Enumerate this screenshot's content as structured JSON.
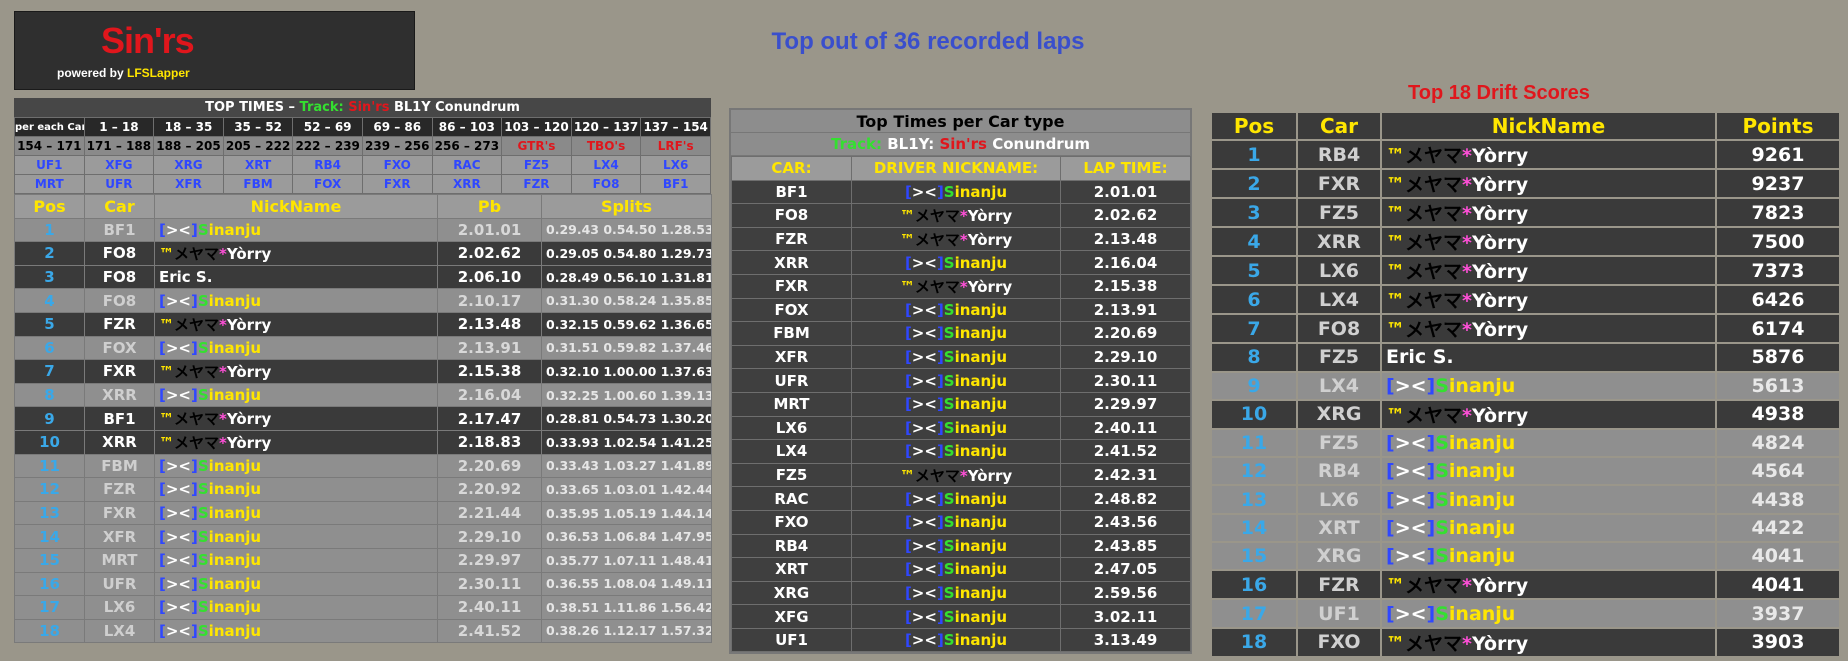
{
  "logo": {
    "main": "Sin'rs",
    "sub_prefix": "powered by ",
    "sub_brand": "LFSLapper"
  },
  "main_title": "Top out of 36 recorded laps",
  "drift_title": "Top 18 Drift Scores",
  "panel1": {
    "title_prefix": "TOP TIMES –",
    "track_label": "Track:",
    "track_team": "Sin'rs",
    "track_name": "BL1Y Conundrum",
    "grid_row1": [
      "per each Car",
      "1 – 18",
      "18 – 35",
      "35 – 52",
      "52 – 69",
      "69 – 86",
      "86 – 103",
      "103 – 120",
      "120 – 137",
      "137 – 154"
    ],
    "grid_row2": [
      "154 – 171",
      "171 – 188",
      "188 – 205",
      "205 – 222",
      "222 – 239",
      "239 – 256",
      "256 – 273",
      "GTR's",
      "TBO's",
      "LRF's"
    ],
    "grid_row3": [
      "UF1",
      "XFG",
      "XRG",
      "XRT",
      "RB4",
      "FXO",
      "RAC",
      "FZ5",
      "LX4",
      "LX6"
    ],
    "grid_row4": [
      "MRT",
      "UFR",
      "XFR",
      "FBM",
      "FOX",
      "FXR",
      "XRR",
      "FZR",
      "FO8",
      "BF1"
    ],
    "headers": [
      "Pos",
      "Car",
      "NickName",
      "Pb",
      "Splits"
    ],
    "rows": [
      {
        "pos": "1",
        "car": "BF1",
        "nick": "sinanju",
        "pb": "2.01.01",
        "splits": "0.29.43 0.54.50 1.28.53",
        "shade": "light"
      },
      {
        "pos": "2",
        "car": "FO8",
        "nick": "yorry",
        "pb": "2.02.62",
        "splits": "0.29.05 0.54.80 1.29.73",
        "shade": "dark"
      },
      {
        "pos": "3",
        "car": "FO8",
        "nick": "eric",
        "pb": "2.06.10",
        "splits": "0.28.49 0.56.10 1.31.81",
        "shade": "dark"
      },
      {
        "pos": "4",
        "car": "FO8",
        "nick": "sinanju",
        "pb": "2.10.17",
        "splits": "0.31.30 0.58.24 1.35.85",
        "shade": "light"
      },
      {
        "pos": "5",
        "car": "FZR",
        "nick": "yorry",
        "pb": "2.13.48",
        "splits": "0.32.15 0.59.62 1.36.65",
        "shade": "dark"
      },
      {
        "pos": "6",
        "car": "FOX",
        "nick": "sinanju",
        "pb": "2.13.91",
        "splits": "0.31.51 0.59.82 1.37.46",
        "shade": "light"
      },
      {
        "pos": "7",
        "car": "FXR",
        "nick": "yorry",
        "pb": "2.15.38",
        "splits": "0.32.10 1.00.00 1.37.63",
        "shade": "dark"
      },
      {
        "pos": "8",
        "car": "XRR",
        "nick": "sinanju",
        "pb": "2.16.04",
        "splits": "0.32.25 1.00.60 1.39.13",
        "shade": "light"
      },
      {
        "pos": "9",
        "car": "BF1",
        "nick": "yorry",
        "pb": "2.17.47",
        "splits": "0.28.81 0.54.73 1.30.20",
        "shade": "dark"
      },
      {
        "pos": "10",
        "car": "XRR",
        "nick": "yorry",
        "pb": "2.18.83",
        "splits": "0.33.93 1.02.54 1.41.25",
        "shade": "dark"
      },
      {
        "pos": "11",
        "car": "FBM",
        "nick": "sinanju",
        "pb": "2.20.69",
        "splits": "0.33.43 1.03.27 1.41.89",
        "shade": "light"
      },
      {
        "pos": "12",
        "car": "FZR",
        "nick": "sinanju",
        "pb": "2.20.92",
        "splits": "0.33.65 1.03.01 1.42.44",
        "shade": "light"
      },
      {
        "pos": "13",
        "car": "FXR",
        "nick": "sinanju",
        "pb": "2.21.44",
        "splits": "0.35.95 1.05.19 1.44.14",
        "shade": "light"
      },
      {
        "pos": "14",
        "car": "XFR",
        "nick": "sinanju",
        "pb": "2.29.10",
        "splits": "0.36.53 1.06.84 1.47.95",
        "shade": "light"
      },
      {
        "pos": "15",
        "car": "MRT",
        "nick": "sinanju",
        "pb": "2.29.97",
        "splits": "0.35.77 1.07.11 1.48.41",
        "shade": "light"
      },
      {
        "pos": "16",
        "car": "UFR",
        "nick": "sinanju",
        "pb": "2.30.11",
        "splits": "0.36.55 1.08.04 1.49.11",
        "shade": "light"
      },
      {
        "pos": "17",
        "car": "LX6",
        "nick": "sinanju",
        "pb": "2.40.11",
        "splits": "0.38.51 1.11.86 1.56.42",
        "shade": "light"
      },
      {
        "pos": "18",
        "car": "LX4",
        "nick": "sinanju",
        "pb": "2.41.52",
        "splits": "0.38.26 1.12.17 1.57.32",
        "shade": "light"
      }
    ]
  },
  "panel2": {
    "title": "Top Times per Car type",
    "track_label": "Track:",
    "track_prefix": "BL1Y:",
    "track_team": "Sin'rs",
    "track_name": "Conundrum",
    "headers": [
      "CAR:",
      "DRIVER NICKNAME:",
      "LAP TIME:"
    ],
    "rows": [
      {
        "car": "BF1",
        "nick": "sinanju",
        "time": "2.01.01"
      },
      {
        "car": "FO8",
        "nick": "yorry",
        "time": "2.02.62"
      },
      {
        "car": "FZR",
        "nick": "yorry",
        "time": "2.13.48"
      },
      {
        "car": "XRR",
        "nick": "sinanju",
        "time": "2.16.04"
      },
      {
        "car": "FXR",
        "nick": "yorry",
        "time": "2.15.38"
      },
      {
        "car": "FOX",
        "nick": "sinanju",
        "time": "2.13.91"
      },
      {
        "car": "FBM",
        "nick": "sinanju",
        "time": "2.20.69"
      },
      {
        "car": "XFR",
        "nick": "sinanju",
        "time": "2.29.10"
      },
      {
        "car": "UFR",
        "nick": "sinanju",
        "time": "2.30.11"
      },
      {
        "car": "MRT",
        "nick": "sinanju",
        "time": "2.29.97"
      },
      {
        "car": "LX6",
        "nick": "sinanju",
        "time": "2.40.11"
      },
      {
        "car": "LX4",
        "nick": "sinanju",
        "time": "2.41.52"
      },
      {
        "car": "FZ5",
        "nick": "yorry",
        "time": "2.42.31"
      },
      {
        "car": "RAC",
        "nick": "sinanju",
        "time": "2.48.82"
      },
      {
        "car": "FXO",
        "nick": "sinanju",
        "time": "2.43.56"
      },
      {
        "car": "RB4",
        "nick": "sinanju",
        "time": "2.43.85"
      },
      {
        "car": "XRT",
        "nick": "sinanju",
        "time": "2.47.05"
      },
      {
        "car": "XRG",
        "nick": "sinanju",
        "time": "2.59.56"
      },
      {
        "car": "XFG",
        "nick": "sinanju",
        "time": "3.02.11"
      },
      {
        "car": "UF1",
        "nick": "sinanju",
        "time": "3.13.49"
      }
    ]
  },
  "panel3": {
    "headers": [
      "Pos",
      "Car",
      "NickName",
      "Points"
    ],
    "rows": [
      {
        "pos": "1",
        "car": "RB4",
        "nick": "yorry",
        "points": "9261",
        "shade": "dark"
      },
      {
        "pos": "2",
        "car": "FXR",
        "nick": "yorry",
        "points": "9237",
        "shade": "dark"
      },
      {
        "pos": "3",
        "car": "FZ5",
        "nick": "yorry",
        "points": "7823",
        "shade": "dark"
      },
      {
        "pos": "4",
        "car": "XRR",
        "nick": "yorry",
        "points": "7500",
        "shade": "dark"
      },
      {
        "pos": "5",
        "car": "LX6",
        "nick": "yorry",
        "points": "7373",
        "shade": "dark"
      },
      {
        "pos": "6",
        "car": "LX4",
        "nick": "yorry",
        "points": "6426",
        "shade": "dark"
      },
      {
        "pos": "7",
        "car": "FO8",
        "nick": "yorry",
        "points": "6174",
        "shade": "dark"
      },
      {
        "pos": "8",
        "car": "FZ5",
        "nick": "eric",
        "points": "5876",
        "shade": "dark"
      },
      {
        "pos": "9",
        "car": "LX4",
        "nick": "sinanju",
        "points": "5613",
        "shade": "light"
      },
      {
        "pos": "10",
        "car": "XRG",
        "nick": "yorry",
        "points": "4938",
        "shade": "dark"
      },
      {
        "pos": "11",
        "car": "FZ5",
        "nick": "sinanju",
        "points": "4824",
        "shade": "light"
      },
      {
        "pos": "12",
        "car": "RB4",
        "nick": "sinanju",
        "points": "4564",
        "shade": "light"
      },
      {
        "pos": "13",
        "car": "LX6",
        "nick": "sinanju",
        "points": "4438",
        "shade": "light"
      },
      {
        "pos": "14",
        "car": "XRT",
        "nick": "sinanju",
        "points": "4422",
        "shade": "light"
      },
      {
        "pos": "15",
        "car": "XRG",
        "nick": "sinanju",
        "points": "4041",
        "shade": "light"
      },
      {
        "pos": "16",
        "car": "FZR",
        "nick": "yorry",
        "points": "4041",
        "shade": "dark"
      },
      {
        "pos": "17",
        "car": "UF1",
        "nick": "sinanju",
        "points": "3937",
        "shade": "light"
      },
      {
        "pos": "18",
        "car": "FXO",
        "nick": "yorry",
        "points": "3903",
        "shade": "dark"
      }
    ]
  },
  "nicknames": {
    "sinanju": {
      "b1": "[",
      "g1": "><",
      "b2": "]",
      "s1": "S",
      "rest": "inanju"
    },
    "yorry": {
      "tm": "™",
      "kana": "メヤマ",
      "star": "*",
      "name": "Yòrry"
    },
    "eric": {
      "name": "Eric S."
    }
  }
}
